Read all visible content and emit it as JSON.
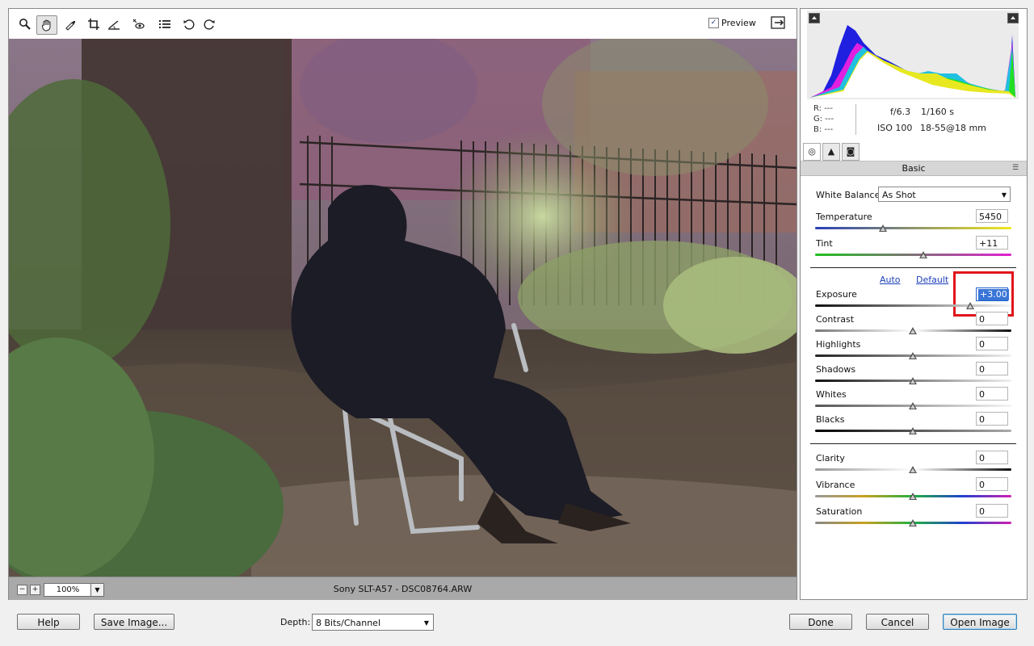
{
  "toolbar": {
    "tools": [
      "zoom-tool",
      "hand-tool",
      "white-balance-tool",
      "crop-tool",
      "straighten-tool",
      "red-eye-tool",
      "preferences",
      "rotate-left",
      "rotate-right"
    ],
    "preview_label": "Preview",
    "preview_checked": true
  },
  "status": {
    "zoom_minus": "−",
    "zoom_plus": "+",
    "zoom_value": "100%",
    "file_caption": "Sony SLT-A57  -  DSC08764.ARW"
  },
  "info": {
    "r": "R:  ---",
    "g": "G:  ---",
    "b": "B:  ---",
    "aperture": "f/6.3",
    "shutter": "1/160 s",
    "iso": "ISO 100",
    "lens": "18-55@18 mm"
  },
  "panel": {
    "tab_icons": [
      "basic-tab-icon",
      "tone-curve-tab-icon",
      "camera-calibration-tab-icon"
    ],
    "title": "Basic"
  },
  "controls": {
    "white_balance_label": "White Balance:",
    "white_balance_value": "As Shot",
    "temperature_label": "Temperature",
    "temperature_value": "5450",
    "tint_label": "Tint",
    "tint_value": "+11",
    "auto_label": "Auto",
    "default_label": "Default",
    "exposure_label": "Exposure",
    "exposure_value": "+3.00",
    "contrast_label": "Contrast",
    "contrast_value": "0",
    "highlights_label": "Highlights",
    "highlights_value": "0",
    "shadows_label": "Shadows",
    "shadows_value": "0",
    "whites_label": "Whites",
    "whites_value": "0",
    "blacks_label": "Blacks",
    "blacks_value": "0",
    "clarity_label": "Clarity",
    "clarity_value": "0",
    "vibrance_label": "Vibrance",
    "vibrance_value": "0",
    "saturation_label": "Saturation",
    "saturation_value": "0"
  },
  "footer": {
    "help": "Help",
    "save_image": "Save Image...",
    "depth_label": "Depth:",
    "depth_value": "8 Bits/Channel",
    "done": "Done",
    "cancel": "Cancel",
    "open_image": "Open Image"
  },
  "colors": {
    "highlight_box": "#e0151b",
    "link": "#1d3fbb",
    "selection": "#3875d7"
  }
}
